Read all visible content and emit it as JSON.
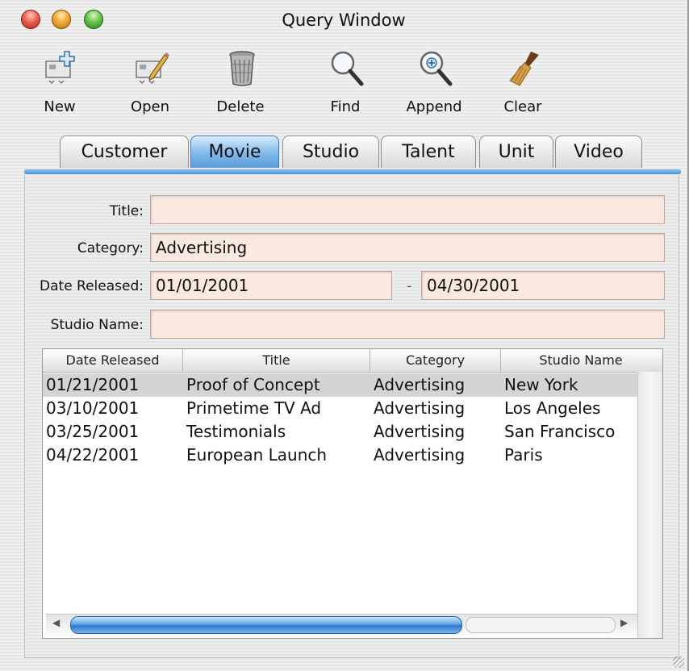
{
  "window": {
    "title": "Query Window"
  },
  "toolbar": [
    {
      "label": "New",
      "icon": "new-record-icon"
    },
    {
      "label": "Open",
      "icon": "edit-record-icon"
    },
    {
      "label": "Delete",
      "icon": "trash-icon"
    },
    {
      "label": "Find",
      "icon": "magnifier-icon"
    },
    {
      "label": "Append",
      "icon": "magnifier-plus-icon"
    },
    {
      "label": "Clear",
      "icon": "broom-icon"
    }
  ],
  "tabs": [
    {
      "label": "Customer"
    },
    {
      "label": "Movie",
      "active": true
    },
    {
      "label": "Studio"
    },
    {
      "label": "Talent"
    },
    {
      "label": "Unit"
    },
    {
      "label": "Video"
    }
  ],
  "form": {
    "title_label": "Title:",
    "title_value": "",
    "category_label": "Category:",
    "category_value": "Advertising",
    "date_label": "Date Released:",
    "date_from": "01/01/2001",
    "date_sep": "-",
    "date_to": "04/30/2001",
    "studio_label": "Studio Name:",
    "studio_value": ""
  },
  "table": {
    "columns": [
      "Date Released",
      "Title",
      "Category",
      "Studio Name"
    ],
    "rows": [
      [
        "01/21/2001",
        "Proof of Concept",
        "Advertising",
        "New York"
      ],
      [
        "03/10/2001",
        "Primetime TV Ad",
        "Advertising",
        "Los Angeles"
      ],
      [
        "03/25/2001",
        "Testimonials",
        "Advertising",
        "San Francisco"
      ],
      [
        "04/22/2001",
        "European Launch",
        "Advertising",
        "Paris"
      ]
    ],
    "selected_row": 0
  },
  "colors": {
    "field_bg": "#fbe9df",
    "accent": "#5d9cd8",
    "selected_row": "#d4d4d4"
  }
}
